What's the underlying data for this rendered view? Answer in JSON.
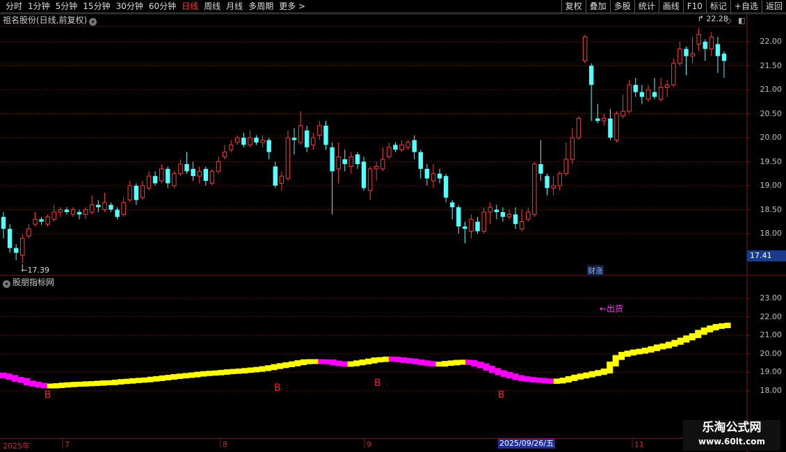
{
  "toolbar": {
    "periods": [
      "分时",
      "1分钟",
      "5分钟",
      "15分钟",
      "30分钟",
      "60分钟",
      "日线",
      "周线",
      "月线",
      "多周期",
      "更多 >"
    ],
    "active_period": "日线",
    "right_buttons": [
      "复权",
      "叠加",
      "多股",
      "统计",
      "画线",
      "F10",
      "标记",
      "+自选",
      "返回"
    ]
  },
  "main_panel": {
    "title": "祖名股份(日线,前复权)",
    "high_label": "22.28",
    "low_label": "17.39",
    "current_price": "17.41",
    "event_tag": "财涨",
    "y_ticks": [
      "22.00",
      "21.50",
      "21.00",
      "20.50",
      "20.00",
      "19.50",
      "19.00",
      "18.50",
      "18.00"
    ]
  },
  "indicator_panel": {
    "title": "股朋指标网",
    "y_ticks": [
      "23.00",
      "22.00",
      "21.00",
      "20.00",
      "19.00",
      "18.00"
    ],
    "sell_label": "←出货",
    "buy_label": "B"
  },
  "x_axis": {
    "labels": [
      "2025年",
      "7",
      "8",
      "9",
      "11"
    ],
    "selected_date": "2025/09/26/五"
  },
  "watermark": {
    "line1": "乐淘公式网",
    "line2": "www.60lt.com"
  },
  "colors": {
    "up": "#ff3c3c",
    "down": "#54ffff",
    "indicator_up": "#ffff00",
    "indicator_down": "#ff00ff",
    "grid": "#7a1a1a"
  },
  "chart_data": {
    "type": "candlestick",
    "candles": [
      [
        18.35,
        18.1,
        18.45,
        17.9
      ],
      [
        18.1,
        17.7,
        18.2,
        17.6
      ],
      [
        17.7,
        17.6,
        17.78,
        17.45
      ],
      [
        17.55,
        17.9,
        17.98,
        17.39
      ],
      [
        17.95,
        18.1,
        18.2,
        17.9
      ],
      [
        18.2,
        18.3,
        18.45,
        18.15
      ],
      [
        18.3,
        18.25,
        18.35,
        18.18
      ],
      [
        18.2,
        18.35,
        18.4,
        18.15
      ],
      [
        18.3,
        18.45,
        18.6,
        18.25
      ],
      [
        18.45,
        18.5,
        18.55,
        18.35
      ],
      [
        18.5,
        18.45,
        18.55,
        18.4
      ],
      [
        18.4,
        18.5,
        18.55,
        18.35
      ],
      [
        18.45,
        18.4,
        18.5,
        18.3
      ],
      [
        18.4,
        18.5,
        18.55,
        18.3
      ],
      [
        18.45,
        18.6,
        18.8,
        18.4
      ],
      [
        18.6,
        18.55,
        18.7,
        18.45
      ],
      [
        18.5,
        18.65,
        18.85,
        18.45
      ],
      [
        18.6,
        18.5,
        18.65,
        18.45
      ],
      [
        18.5,
        18.35,
        18.55,
        18.3
      ],
      [
        18.4,
        18.65,
        18.75,
        18.35
      ],
      [
        18.7,
        19.0,
        19.1,
        18.65
      ],
      [
        19.0,
        18.7,
        19.05,
        18.6
      ],
      [
        18.75,
        19.0,
        19.1,
        18.7
      ],
      [
        18.95,
        19.2,
        19.3,
        18.9
      ],
      [
        19.2,
        19.05,
        19.3,
        19.0
      ],
      [
        19.1,
        19.35,
        19.45,
        19.05
      ],
      [
        19.35,
        19.05,
        19.4,
        18.95
      ],
      [
        19.0,
        19.25,
        19.3,
        18.95
      ],
      [
        19.25,
        19.45,
        19.55,
        19.2
      ],
      [
        19.45,
        19.3,
        19.7,
        19.25
      ],
      [
        19.35,
        19.2,
        19.5,
        19.1
      ],
      [
        19.2,
        19.3,
        19.4,
        19.05
      ],
      [
        19.35,
        19.1,
        19.4,
        19.0
      ],
      [
        19.05,
        19.3,
        19.35,
        19.0
      ],
      [
        19.3,
        19.5,
        19.6,
        19.25
      ],
      [
        19.6,
        19.7,
        19.85,
        19.55
      ],
      [
        19.75,
        19.85,
        19.95,
        19.7
      ],
      [
        19.9,
        20.0,
        20.05,
        19.85
      ],
      [
        20.0,
        19.85,
        20.1,
        19.8
      ],
      [
        19.85,
        20.0,
        20.15,
        19.8
      ],
      [
        20.0,
        19.9,
        20.05,
        19.85
      ],
      [
        19.9,
        19.95,
        20.05,
        19.8
      ],
      [
        19.95,
        19.7,
        20.0,
        19.55
      ],
      [
        19.4,
        19.0,
        19.5,
        18.95
      ],
      [
        19.05,
        19.2,
        19.3,
        18.9
      ],
      [
        19.15,
        20.0,
        20.15,
        19.1
      ],
      [
        20.0,
        19.95,
        20.2,
        19.65
      ],
      [
        19.9,
        20.25,
        20.55,
        19.85
      ],
      [
        20.15,
        19.8,
        20.25,
        19.7
      ],
      [
        19.85,
        20.0,
        20.1,
        19.75
      ],
      [
        20.05,
        20.25,
        20.35,
        19.95
      ],
      [
        20.25,
        19.85,
        20.35,
        19.75
      ],
      [
        19.8,
        19.3,
        19.9,
        18.4
      ],
      [
        19.35,
        19.6,
        19.9,
        19.05
      ],
      [
        19.55,
        19.45,
        19.75,
        19.3
      ],
      [
        19.4,
        19.6,
        19.7,
        19.25
      ],
      [
        19.65,
        19.45,
        19.7,
        19.35
      ],
      [
        19.5,
        18.95,
        19.6,
        18.9
      ],
      [
        18.9,
        19.35,
        19.4,
        18.7
      ],
      [
        19.35,
        19.4,
        19.5,
        19.1
      ],
      [
        19.35,
        19.55,
        19.8,
        19.3
      ],
      [
        19.6,
        19.8,
        19.9,
        19.55
      ],
      [
        19.85,
        19.75,
        19.9,
        19.7
      ],
      [
        19.75,
        19.85,
        19.95,
        19.7
      ],
      [
        19.8,
        19.9,
        19.95,
        19.75
      ],
      [
        19.95,
        19.7,
        20.05,
        19.55
      ],
      [
        19.7,
        19.35,
        19.75,
        19.15
      ],
      [
        19.35,
        19.15,
        19.45,
        19.0
      ],
      [
        19.1,
        19.25,
        19.45,
        18.95
      ],
      [
        19.25,
        19.15,
        19.35,
        19.05
      ],
      [
        19.2,
        18.75,
        19.25,
        18.65
      ],
      [
        18.65,
        18.55,
        18.7,
        18.3
      ],
      [
        18.55,
        18.15,
        18.6,
        18.0
      ],
      [
        18.15,
        18.1,
        18.25,
        17.8
      ],
      [
        18.05,
        18.3,
        18.4,
        17.9
      ],
      [
        18.25,
        18.05,
        18.35,
        18.0
      ],
      [
        18.05,
        18.45,
        18.55,
        18.0
      ],
      [
        18.45,
        18.55,
        18.65,
        18.2
      ],
      [
        18.5,
        18.45,
        18.6,
        18.3
      ],
      [
        18.45,
        18.35,
        18.55,
        18.25
      ],
      [
        18.35,
        18.4,
        18.5,
        18.3
      ],
      [
        18.4,
        18.2,
        18.55,
        18.1
      ],
      [
        18.1,
        18.25,
        18.5,
        18.05
      ],
      [
        18.3,
        18.45,
        18.55,
        18.25
      ],
      [
        18.4,
        19.45,
        19.5,
        18.35
      ],
      [
        19.45,
        19.25,
        19.95,
        19.1
      ],
      [
        19.2,
        18.95,
        19.25,
        18.8
      ],
      [
        18.95,
        19.0,
        19.2,
        18.8
      ],
      [
        19.0,
        19.25,
        19.3,
        18.9
      ],
      [
        19.25,
        19.55,
        19.9,
        19.2
      ],
      [
        19.55,
        20.0,
        20.2,
        19.45
      ],
      [
        20.0,
        20.4,
        20.45,
        19.95
      ],
      [
        21.6,
        22.1,
        22.15,
        21.55
      ],
      [
        21.5,
        21.1,
        21.55,
        20.35
      ],
      [
        20.4,
        20.35,
        20.7,
        20.3
      ],
      [
        20.35,
        20.4,
        20.5,
        20.25
      ],
      [
        20.4,
        20.0,
        20.6,
        19.95
      ],
      [
        19.95,
        20.5,
        20.55,
        19.9
      ],
      [
        20.45,
        20.55,
        20.9,
        20.4
      ],
      [
        20.55,
        21.1,
        21.2,
        20.5
      ],
      [
        21.1,
        20.95,
        21.25,
        20.85
      ],
      [
        20.95,
        20.85,
        21.1,
        20.7
      ],
      [
        20.8,
        21.0,
        21.1,
        20.75
      ],
      [
        20.95,
        20.85,
        21.25,
        20.8
      ],
      [
        20.8,
        21.05,
        21.25,
        20.75
      ],
      [
        21.05,
        21.1,
        21.2,
        20.85
      ],
      [
        21.1,
        21.55,
        21.65,
        21.05
      ],
      [
        21.55,
        21.85,
        22.0,
        21.5
      ],
      [
        21.85,
        21.7,
        21.9,
        21.3
      ],
      [
        21.7,
        21.75,
        22.1,
        21.55
      ],
      [
        21.95,
        22.15,
        22.28,
        21.8
      ],
      [
        22.0,
        21.85,
        22.05,
        21.6
      ],
      [
        21.85,
        22.1,
        22.2,
        21.7
      ],
      [
        21.95,
        21.7,
        22.1,
        21.35
      ],
      [
        21.75,
        21.6,
        21.8,
        21.25
      ]
    ],
    "indicator": [
      18.85,
      18.8,
      18.72,
      18.62,
      18.56,
      18.42,
      18.36,
      18.3,
      18.26,
      18.26,
      18.28,
      18.31,
      18.33,
      18.35,
      18.36,
      18.38,
      18.39,
      18.41,
      18.43,
      18.44,
      18.47,
      18.5,
      18.52,
      18.55,
      18.57,
      18.59,
      18.63,
      18.66,
      18.7,
      18.73,
      18.77,
      18.8,
      18.83,
      18.86,
      18.9,
      18.93,
      18.95,
      18.97,
      19.0,
      19.03,
      19.05,
      19.07,
      19.1,
      19.13,
      19.16,
      19.2,
      19.25,
      19.31,
      19.36,
      19.41,
      19.46,
      19.52,
      19.57,
      19.58,
      19.58,
      19.57,
      19.56,
      19.5,
      19.46,
      19.43,
      19.46,
      19.51,
      19.56,
      19.61,
      19.67,
      19.69,
      19.72,
      19.71,
      19.68,
      19.64,
      19.61,
      19.56,
      19.51,
      19.47,
      19.44,
      19.44,
      19.48,
      19.51,
      19.54,
      19.55,
      19.53,
      19.44,
      19.35,
      19.22,
      19.09,
      18.98,
      18.88,
      18.8,
      18.71,
      18.65,
      18.61,
      18.58,
      18.56,
      18.53,
      18.51,
      18.53,
      18.58,
      18.66,
      18.74,
      18.8,
      18.86,
      18.93,
      18.99,
      19.07,
      19.45,
      19.8,
      19.97,
      20.04,
      20.1,
      20.14,
      20.2,
      20.28,
      20.37,
      20.43,
      20.52,
      20.62,
      20.74,
      20.86,
      20.98,
      21.16,
      21.29,
      21.4,
      21.48,
      21.52,
      21.55
    ],
    "buy_marks_at_index": [
      7,
      43,
      59,
      78
    ],
    "buy_label_levels": [
      17.7,
      18.08,
      18.35,
      17.7
    ]
  }
}
